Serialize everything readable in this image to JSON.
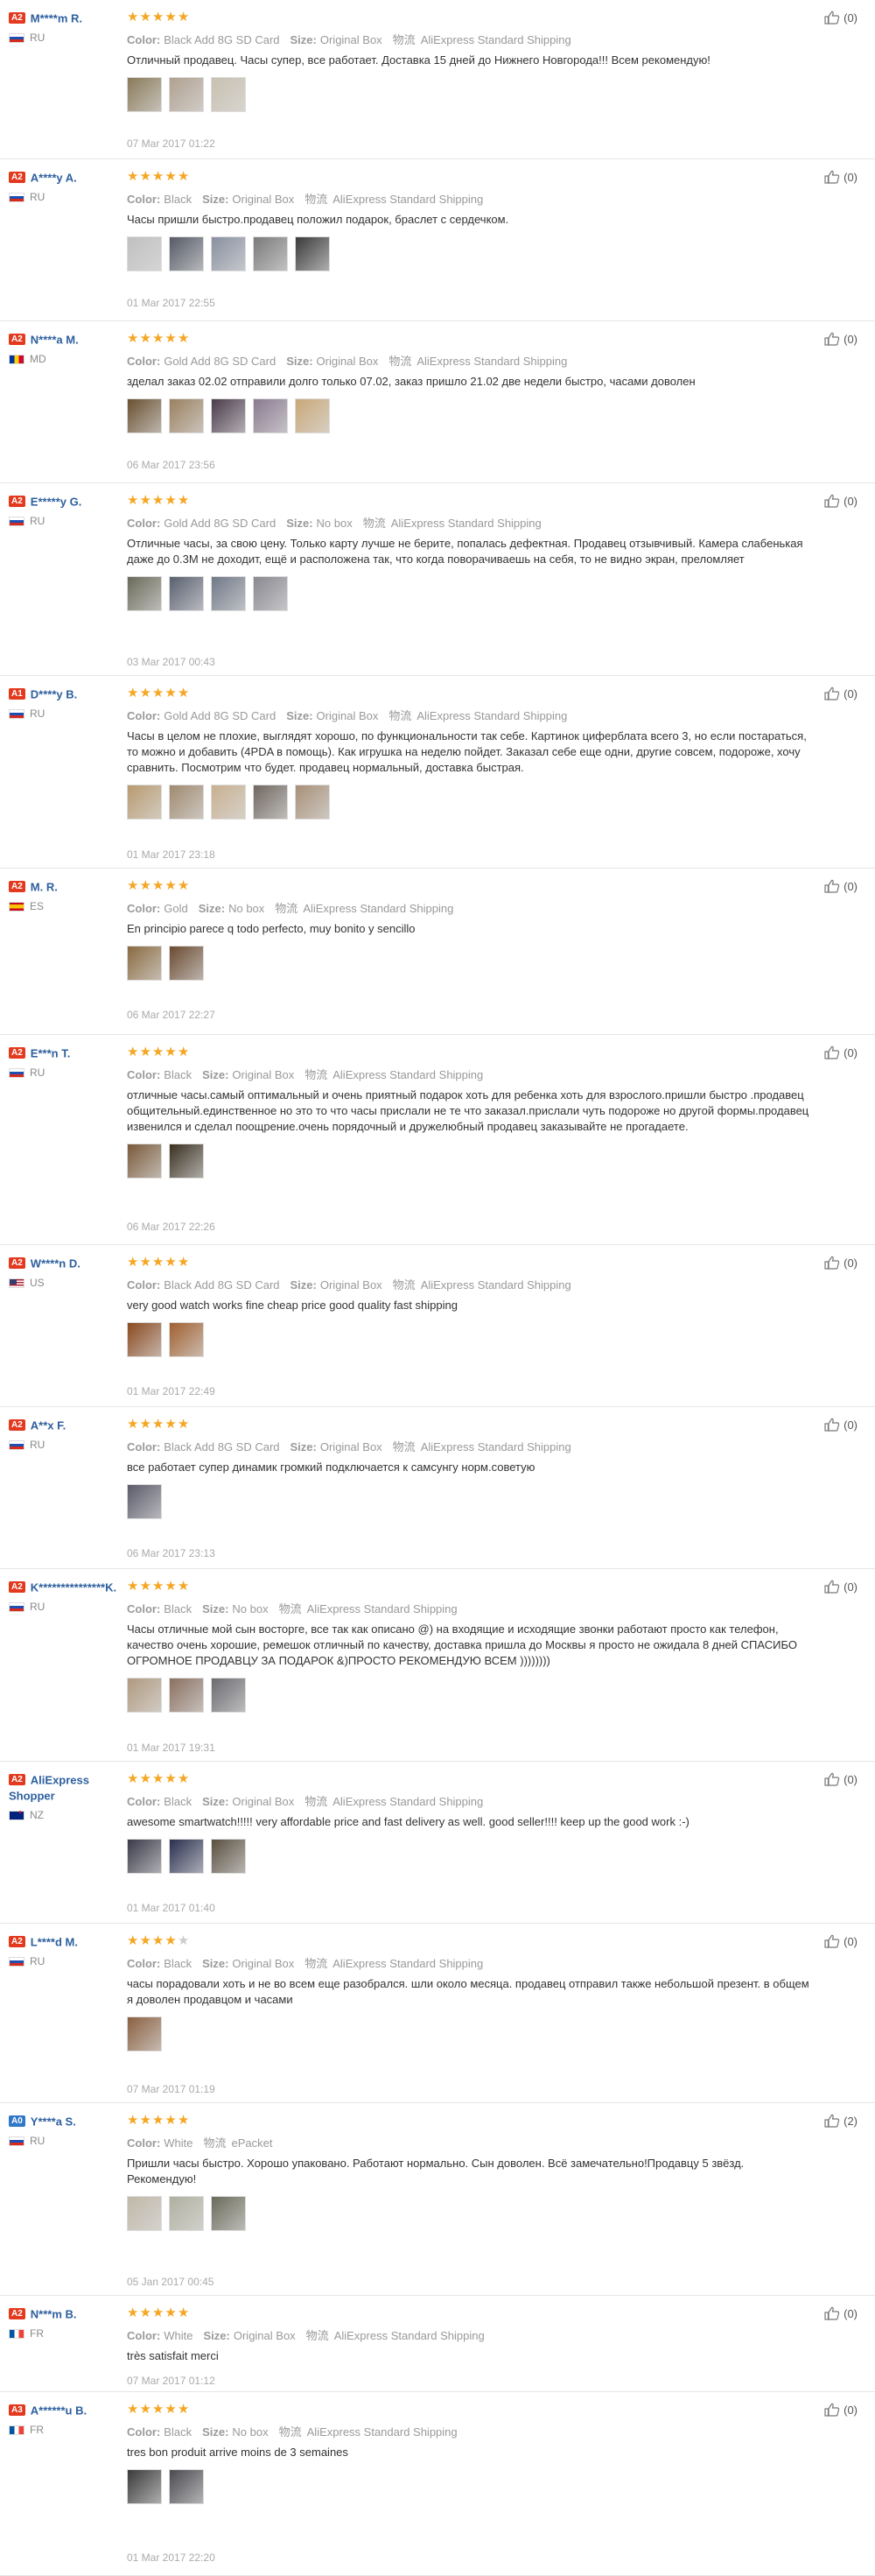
{
  "labels": {
    "color": "Color:",
    "size": "Size:",
    "logistics": "物流"
  },
  "reviews": [
    {
      "level": "A2",
      "name": "M****m R.",
      "country": "RU",
      "flag": "ru",
      "stars": 5,
      "color": "Black Add 8G SD Card",
      "size": "Original Box",
      "logistics": "AliExpress Standard Shipping",
      "text": "Отличный продавец. Часы супер, все работает. Доставка 15 дней до Нижнего Новгорода!!! Всем рекомендую!",
      "photos": [
        "#8a7a5a",
        "#b0a090",
        "#c8c0b0"
      ],
      "date": "07 Mar 2017 01:22",
      "likes": "(0)"
    },
    {
      "level": "A2",
      "name": "A****y A.",
      "country": "RU",
      "flag": "ru",
      "stars": 5,
      "color": "Black",
      "size": "Original Box",
      "logistics": "AliExpress Standard Shipping",
      "text": "Часы пришли быстро.продавец положил подарок, браслет с сердечком.",
      "photos": [
        "#c0c0c0",
        "#555a66",
        "#8890a0",
        "#7a7a7a",
        "#3a3a3a"
      ],
      "date": "01 Mar 2017 22:55",
      "likes": "(0)"
    },
    {
      "level": "A2",
      "name": "N****a M.",
      "country": "MD",
      "flag": "md",
      "stars": 5,
      "color": "Gold Add 8G SD Card",
      "size": "Original Box",
      "logistics": "AliExpress Standard Shipping",
      "text": "зделал заказ 02.02 отправили долго только 07.02, заказ пришло 21.02 две недели быстро, часами доволен",
      "photos": [
        "#6a5030",
        "#9a8060",
        "#4a3a4a",
        "#8a7a90",
        "#c8a878"
      ],
      "date": "06 Mar 2017 23:56",
      "likes": "(0)"
    },
    {
      "level": "A2",
      "name": "E*****y G.",
      "country": "RU",
      "flag": "ru",
      "stars": 5,
      "color": "Gold Add 8G SD Card",
      "size": "No box",
      "logistics": "AliExpress Standard Shipping",
      "text": "Отличные часы, за свою цену. Только карту лучше не берите, попалась дефектная. Продавец отзывчивый. Камера слабенькая даже до 0.3М не доходит, ещё и расположена так, что когда поворачиваешь на себя, то не видно экран, преломляет",
      "photos": [
        "#6a6a5a",
        "#5a6070",
        "#707888",
        "#8a8890"
      ],
      "date": "03 Mar 2017 00:43",
      "likes": "(0)"
    },
    {
      "level": "A1",
      "name": "D****y B.",
      "country": "RU",
      "flag": "ru",
      "stars": 5,
      "color": "Gold Add 8G SD Card",
      "size": "Original Box",
      "logistics": "AliExpress Standard Shipping",
      "text": "Часы в целом не плохие, выглядят хорошо, по функциональности так себе. Картинок циферблата всего 3, но если постараться, то можно и добавить (4PDA в помощь). Как игрушка на неделю пойдет. Заказал себе еще одни, другие совсем, подорожe, хочу сравнить. Посмотрим что будет. продавец нормальный, доставка быстрая.",
      "photos": [
        "#b89a70",
        "#a08a70",
        "#c8b090",
        "#706860",
        "#a89078"
      ],
      "date": "01 Mar 2017 23:18",
      "likes": "(0)"
    },
    {
      "level": "A2",
      "name": "M. R.",
      "country": "ES",
      "flag": "es",
      "stars": 5,
      "color": "Gold",
      "size": "No box",
      "logistics": "AliExpress Standard Shipping",
      "text": "En principio parece q todo perfecto, muy bonito y sencillo",
      "photos": [
        "#8a6a40",
        "#6a4a30"
      ],
      "date": "06 Mar 2017 22:27",
      "likes": "(0)"
    },
    {
      "level": "A2",
      "name": "E***n T.",
      "country": "RU",
      "flag": "ru",
      "stars": 5,
      "color": "Black",
      "size": "Original Box",
      "logistics": "AliExpress Standard Shipping",
      "text": "отличные часы.самый оптимальный и очень приятный подарок хоть для ребенка хоть для взрослого.пришли быстро .продавец общительный.единственное но это то что часы прислали не те что заказал.прислали чуть подорожe но другой формы.продавец извенился и сделал поощрение.очень порядочный и дружелюбный продавец заказывайте не прогадаете.",
      "photos": [
        "#7a5a3a",
        "#3a3020"
      ],
      "date": "06 Mar 2017 22:26",
      "likes": "(0)"
    },
    {
      "level": "A2",
      "name": "W****n D.",
      "country": "US",
      "flag": "us",
      "stars": 5,
      "color": "Black Add 8G SD Card",
      "size": "Original Box",
      "logistics": "AliExpress Standard Shipping",
      "text": "very good watch works fine cheap price good quality fast shipping",
      "photos": [
        "#8a4a20",
        "#a06030"
      ],
      "date": "01 Mar 2017 22:49",
      "likes": "(0)"
    },
    {
      "level": "A2",
      "name": "A**x F.",
      "country": "RU",
      "flag": "ru",
      "stars": 5,
      "color": "Black Add 8G SD Card",
      "size": "Original Box",
      "logistics": "AliExpress Standard Shipping",
      "text": "все работает супер динамик громкий подключается к самсунгу норм.советую",
      "photos": [
        "#5a5a6a"
      ],
      "date": "06 Mar 2017 23:13",
      "likes": "(0)"
    },
    {
      "level": "A2",
      "name": "K***************K.",
      "country": "RU",
      "flag": "ru",
      "stars": 5,
      "color": "Black",
      "size": "No box",
      "logistics": "AliExpress Standard Shipping",
      "text": "Часы отличные мой сын восторге, все так как описано @) на входящие и исходящие звонки работают просто как телефон, качество очень хорошие, ремешок отличный по качеству, доставка пришла до Москвы я просто не ожидала 8 дней СПАСИБО ОГРОМНОЕ ПРОДАВЦУ ЗА ПОДАРОК &)ПРОСТО РЕКОМЕНДУЮ ВСЕМ ))))))))",
      "photos": [
        "#b09a80",
        "#8a7060",
        "#6a6a70"
      ],
      "date": "01 Mar 2017 19:31",
      "likes": "(0)"
    },
    {
      "level": "A2",
      "name": "AliExpress Shopper",
      "country": "NZ",
      "flag": "nz",
      "stars": 5,
      "color": "Black",
      "size": "Original Box",
      "logistics": "AliExpress Standard Shipping",
      "text": "awesome smartwatch!!!!! very affordable price and fast delivery as well. good seller!!!! keep up the good work :-)",
      "photos": [
        "#3a3a4a",
        "#2a3050",
        "#5a5040"
      ],
      "date": "01 Mar 2017 01:40",
      "likes": "(0)"
    },
    {
      "level": "A2",
      "name": "L****d M.",
      "country": "RU",
      "flag": "ru",
      "stars": 4,
      "color": "Black",
      "size": "Original Box",
      "logistics": "AliExpress Standard Shipping",
      "text": "часы порадовали хоть и не во всем еще разобрался. шли около месяца. продавец отправил также небольшой презент. в общем я доволен продавцом и часами",
      "photos": [
        "#8a6040"
      ],
      "date": "07 Mar 2017 01:19",
      "likes": "(0)"
    },
    {
      "level": "A0",
      "name": "Y****a S.",
      "country": "RU",
      "flag": "ru",
      "stars": 5,
      "color": "White",
      "size": "",
      "logistics": "ePacket",
      "text": "Пришли часы быстро. Хорошо упаковано. Работают нормально. Сын доволен. Всё замечательно!Продавцу 5 звёзд. Рекомендую!",
      "photos": [
        "#c0b8a8",
        "#b0b0a0",
        "#6a6a5a"
      ],
      "date": "05 Jan 2017 00:45",
      "likes": "(2)"
    },
    {
      "level": "A2",
      "name": "N***m B.",
      "country": "FR",
      "flag": "fr",
      "stars": 5,
      "color": "White",
      "size": "Original Box",
      "logistics": "AliExpress Standard Shipping",
      "text": "très satisfait merci",
      "photos": [],
      "date": "07 Mar 2017 01:12",
      "likes": "(0)"
    },
    {
      "level": "A3",
      "name": "A******u B.",
      "country": "FR",
      "flag": "fr",
      "stars": 5,
      "color": "Black",
      "size": "No box",
      "logistics": "AliExpress Standard Shipping",
      "text": "tres bon produit arrive moins de 3 semaines",
      "photos": [
        "#3a3a3a",
        "#4a4a50"
      ],
      "date": "01 Mar 2017 22:20",
      "likes": "(0)"
    }
  ]
}
